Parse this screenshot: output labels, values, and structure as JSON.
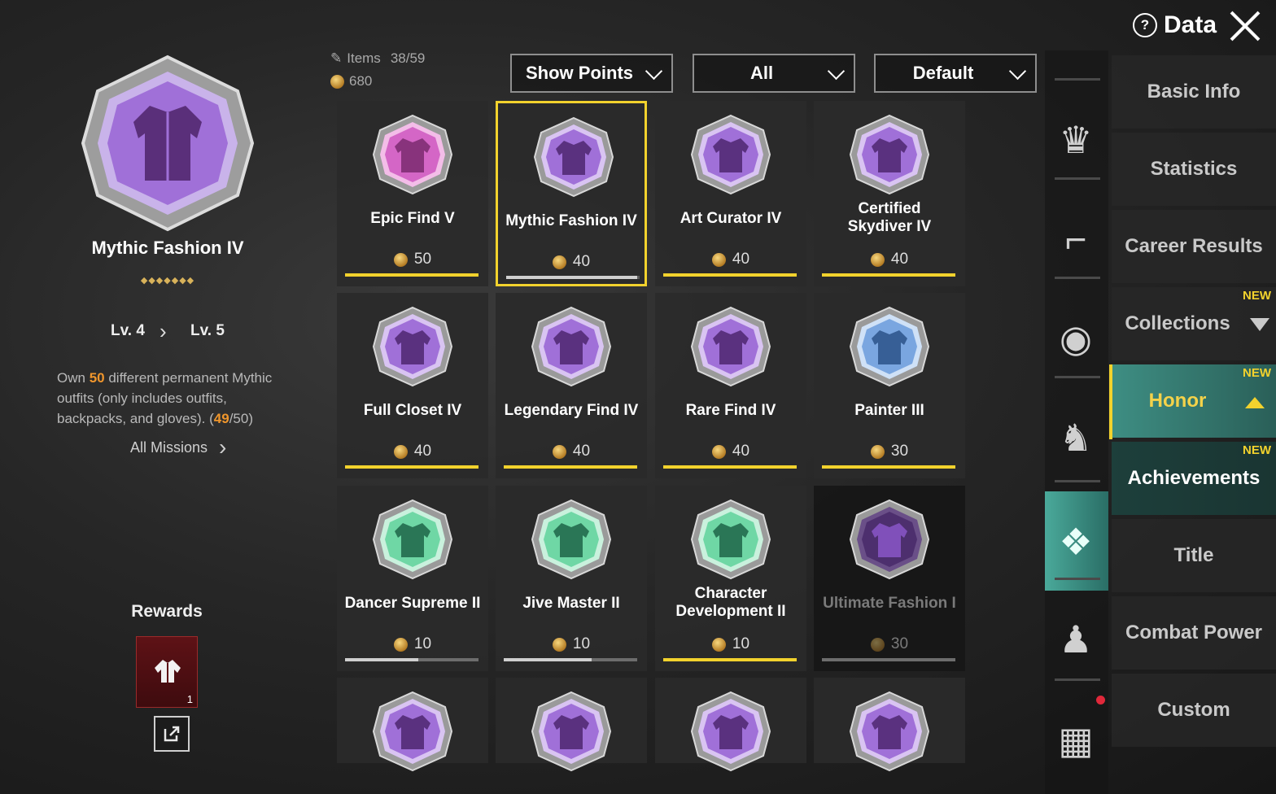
{
  "header": {
    "data_label": "Data"
  },
  "left_panel": {
    "title": "Mythic Fashion IV",
    "stars": "◆◆◆◆◆◆◆",
    "level_from": "Lv. 4",
    "level_to": "Lv. 5",
    "desc_pre": "Own ",
    "desc_num": "50",
    "desc_mid": " different permanent Mythic outfits (only includes outfits, backpacks, and gloves). (",
    "desc_cur": "49",
    "desc_end": "/50)",
    "all_missions": "All Missions",
    "rewards_label": "Rewards",
    "reward_count": "1"
  },
  "stats": {
    "items_label": "Items",
    "items_value": "38/59",
    "points_value": "680"
  },
  "filters": {
    "sort_points": "Show Points",
    "category": "All",
    "order": "Default"
  },
  "colors": {
    "accent": "#f2d22d",
    "purple": "#a070d8",
    "pink": "#d466c6",
    "blue": "#7aa6e0",
    "green": "#6fd7a5",
    "teal": "#3e8e83"
  },
  "honor_cards": [
    {
      "name": "Epic Find V",
      "points": "50",
      "progress": 1.0,
      "badge": "pink",
      "icon": "shirt-icon"
    },
    {
      "name": "Mythic Fashion IV",
      "points": "40",
      "progress": 0.98,
      "badge": "purple",
      "icon": "jacket-icon",
      "selected": true
    },
    {
      "name": "Art Curator IV",
      "points": "40",
      "progress": 1.0,
      "badge": "purple",
      "icon": "claw-icon"
    },
    {
      "name": "Certified Skydiver IV",
      "points": "40",
      "progress": 1.0,
      "badge": "purple",
      "icon": "parachute-icon"
    },
    {
      "name": "Full Closet IV",
      "points": "40",
      "progress": 1.0,
      "badge": "purple",
      "icon": "closet-icon"
    },
    {
      "name": "Legendary Find IV",
      "points": "40",
      "progress": 1.0,
      "badge": "purple",
      "icon": "outfit-icon"
    },
    {
      "name": "Rare Find IV",
      "points": "40",
      "progress": 1.0,
      "badge": "purple",
      "icon": "jacket-icon"
    },
    {
      "name": "Painter III",
      "points": "30",
      "progress": 1.0,
      "badge": "blue",
      "icon": "crosshair-icon"
    },
    {
      "name": "Dancer Supreme II",
      "points": "10",
      "progress": 0.55,
      "badge": "green",
      "icon": "dancer-icon"
    },
    {
      "name": "Jive Master II",
      "points": "10",
      "progress": 0.66,
      "badge": "green",
      "icon": "dancer-icon"
    },
    {
      "name": "Character Development II",
      "points": "10",
      "progress": 1.0,
      "badge": "green",
      "icon": "character-icon"
    },
    {
      "name": "Ultimate Fashion I",
      "points": "30",
      "progress": 0.0,
      "badge": "dark-purple",
      "icon": "gem-icon",
      "dim": true
    },
    {
      "name": "",
      "points": "",
      "badge": "purple",
      "icon": "hexagon-icon",
      "partial": true
    },
    {
      "name": "",
      "points": "",
      "badge": "purple",
      "icon": "rabbit-icon",
      "partial": true
    },
    {
      "name": "",
      "points": "",
      "badge": "purple",
      "icon": "pizza-icon",
      "partial": true
    },
    {
      "name": "",
      "points": "",
      "badge": "purple",
      "icon": "tent-icon",
      "partial": true
    }
  ],
  "side_tabs": [
    {
      "label": "Basic Info"
    },
    {
      "label": "Statistics"
    },
    {
      "label": "Career Results"
    },
    {
      "label": "Collections",
      "new": "NEW"
    },
    {
      "label": "Honor",
      "new": "NEW"
    },
    {
      "label": "Achievements",
      "new": "NEW"
    },
    {
      "label": "Title"
    },
    {
      "label": "Combat Power"
    },
    {
      "label": "Custom"
    }
  ],
  "strip_icons": [
    "crown-icon",
    "pistol-icon",
    "medal-icon",
    "muscle-icon",
    "honor-card-icon",
    "friends-icon",
    "grid-icon"
  ]
}
